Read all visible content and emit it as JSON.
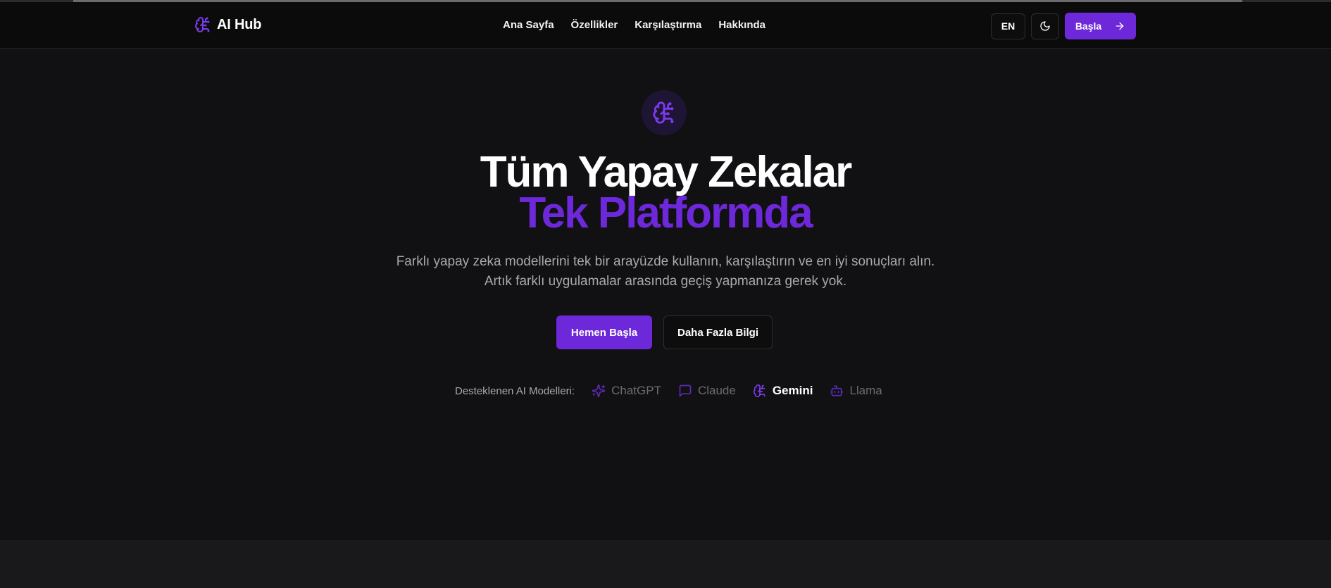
{
  "brand": {
    "name": "AI Hub",
    "icon": "brain-circuit-icon"
  },
  "nav": {
    "items": [
      "Ana Sayfa",
      "Özellikler",
      "Karşılaştırma",
      "Hakkında"
    ]
  },
  "actions": {
    "lang": "EN",
    "theme_icon": "moon-icon",
    "start": "Başla",
    "start_icon": "arrow-right-icon"
  },
  "hero": {
    "icon": "brain-circuit-icon",
    "title_line1": "Tüm Yapay Zekalar",
    "title_line2": "Tek Platformda",
    "subtitle_line1": "Farklı yapay zeka modellerini tek bir arayüzde kullanın, karşılaştırın ve en iyi sonuçları alın.",
    "subtitle_line2": "Artık farklı uygulamalar arasında geçiş yapmanıza gerek yok.",
    "primary_cta": "Hemen Başla",
    "secondary_cta": "Daha Fazla Bilgi"
  },
  "models": {
    "label": "Desteklenen AI Modelleri:",
    "items": [
      {
        "name": "ChatGPT",
        "icon": "sparkles-icon",
        "active": false
      },
      {
        "name": "Claude",
        "icon": "message-square-icon",
        "active": false
      },
      {
        "name": "Gemini",
        "icon": "brain-circuit-icon",
        "active": true
      },
      {
        "name": "Llama",
        "icon": "bot-icon",
        "active": false
      }
    ]
  },
  "colors": {
    "accent": "#6d28d9",
    "background": "#111113",
    "header": "#0b0b0c",
    "muted": "#6b6b70"
  }
}
